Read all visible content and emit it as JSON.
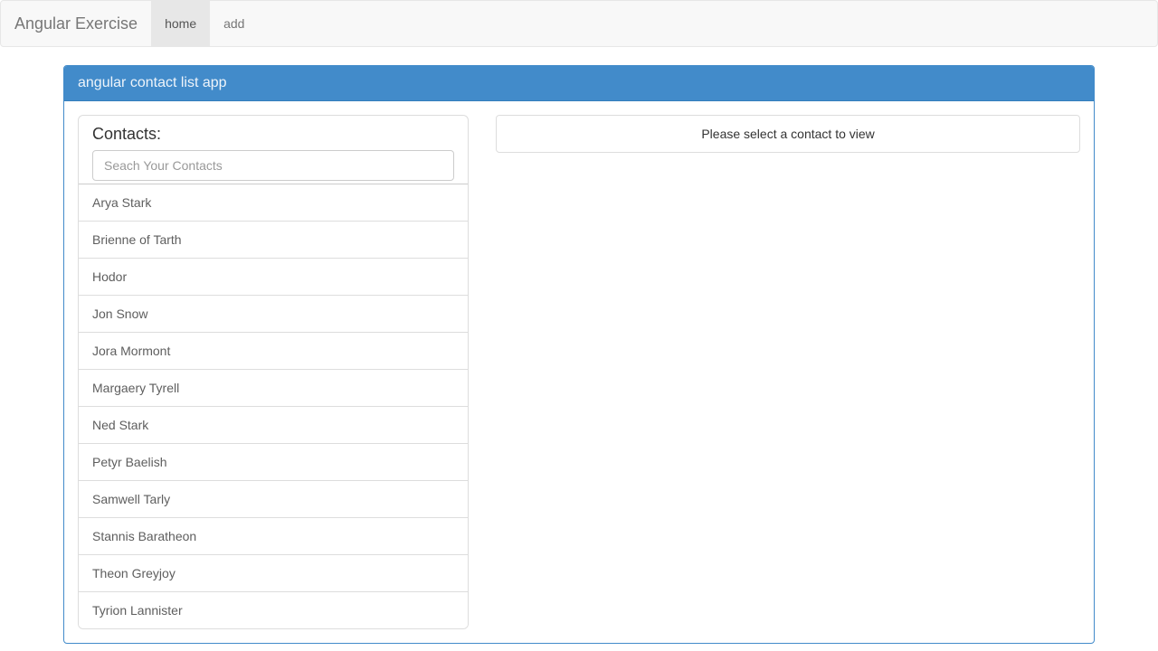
{
  "navbar": {
    "brand": "Angular Exercise",
    "items": [
      {
        "label": "home",
        "active": true
      },
      {
        "label": "add",
        "active": false
      }
    ]
  },
  "panel": {
    "heading": "angular contact list app"
  },
  "contacts_panel": {
    "header": "Contacts:",
    "search_placeholder": "Seach Your Contacts",
    "items": [
      "Arya Stark",
      "Brienne of Tarth",
      "Hodor",
      "Jon Snow",
      "Jora Mormont",
      "Margaery Tyrell",
      "Ned Stark",
      "Petyr Baelish",
      "Samwell Tarly",
      "Stannis Baratheon",
      "Theon Greyjoy",
      "Tyrion Lannister"
    ]
  },
  "detail": {
    "placeholder": "Please select a contact to view"
  }
}
